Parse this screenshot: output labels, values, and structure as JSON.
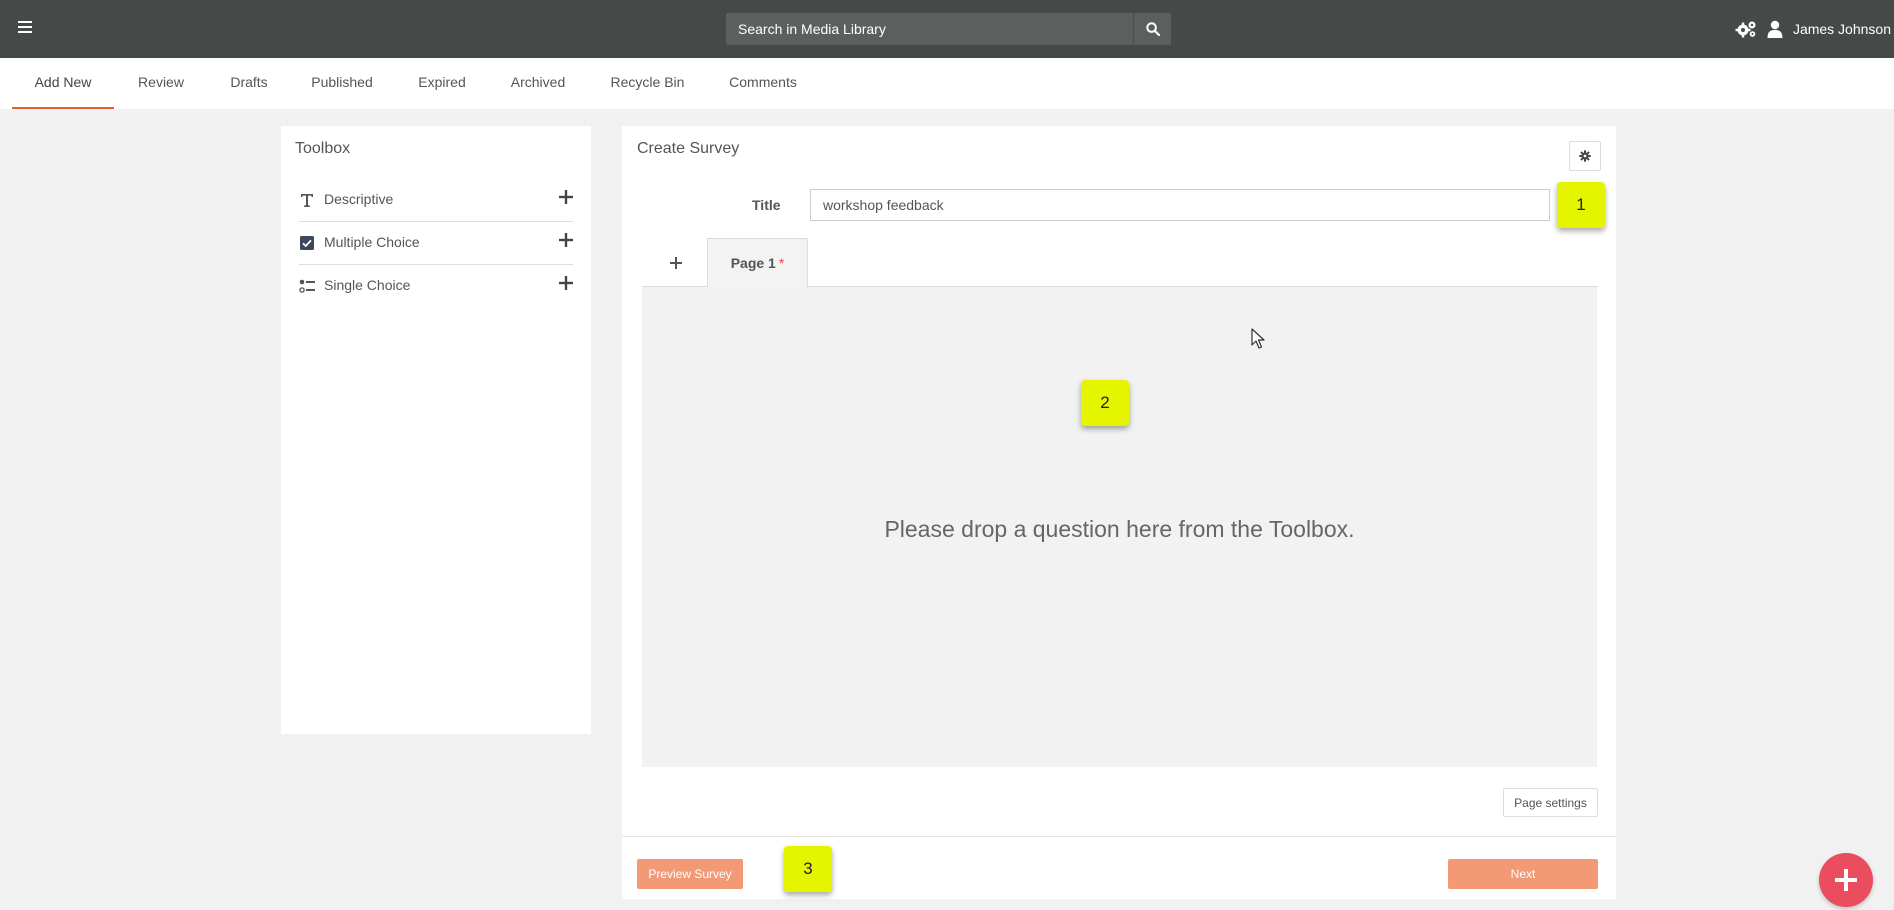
{
  "topbar": {
    "search_placeholder": "Search in Media Library",
    "user_name": "James Johnson",
    "icons": [
      "menu-icon",
      "search-icon",
      "gears-icon",
      "user-icon"
    ],
    "background_color": "#454a49"
  },
  "tabs": [
    {
      "label": "Add New",
      "active": true
    },
    {
      "label": "Review",
      "active": false
    },
    {
      "label": "Drafts",
      "active": false
    },
    {
      "label": "Published",
      "active": false
    },
    {
      "label": "Expired",
      "active": false
    },
    {
      "label": "Archived",
      "active": false
    },
    {
      "label": "Recycle Bin",
      "active": false
    },
    {
      "label": "Comments",
      "active": false
    }
  ],
  "toolbox": {
    "title": "Toolbox",
    "items": [
      {
        "label": "Descriptive",
        "icon": "text-type-icon"
      },
      {
        "label": "Multiple Choice",
        "icon": "checkbox-icon"
      },
      {
        "label": "Single Choice",
        "icon": "radio-list-icon"
      }
    ]
  },
  "survey": {
    "heading": "Create Survey",
    "title_label": "Title",
    "title_value": "workshop feedback",
    "page_tab_label": "Page 1",
    "page_tab_required_mark": "*",
    "dropzone_text": "Please drop a question here from the Toolbox.",
    "page_settings_label": "Page settings",
    "preview_label": "Preview Survey",
    "next_label": "Next"
  },
  "markers": [
    "1",
    "2",
    "3"
  ],
  "colors": {
    "accent": "#e65c2e",
    "button": "#f29a76",
    "marker": "#e5f500",
    "fab": "#ea4d5d"
  }
}
